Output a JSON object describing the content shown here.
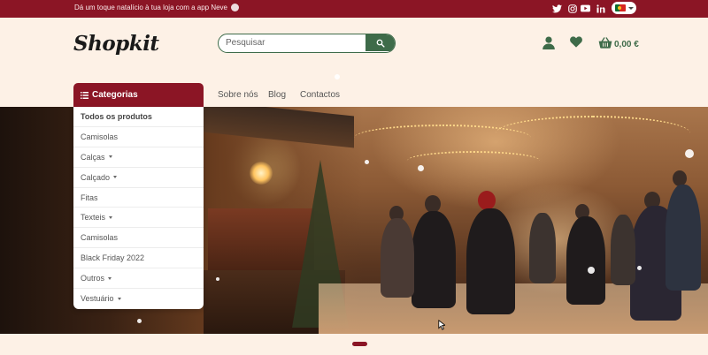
{
  "topbar": {
    "promo": "Dá um toque natalício à tua loja com a app Neve",
    "social": [
      "twitter-icon",
      "instagram-icon",
      "youtube-icon",
      "linkedin-icon"
    ],
    "language_flag": "pt-flag"
  },
  "header": {
    "logo": "Shopkit",
    "search_placeholder": "Pesquisar",
    "cart_total": "0,00 €"
  },
  "nav": {
    "categories_label": "Categorias",
    "links": [
      "Sobre nós",
      "Blog",
      "Contactos"
    ]
  },
  "categories": [
    {
      "label": "Todos os produtos",
      "has_submenu": false
    },
    {
      "label": "Camisolas",
      "has_submenu": false
    },
    {
      "label": "Calças",
      "has_submenu": true
    },
    {
      "label": "Calçado",
      "has_submenu": true
    },
    {
      "label": "Fitas",
      "has_submenu": false
    },
    {
      "label": "Texteis",
      "has_submenu": true
    },
    {
      "label": "Camisolas",
      "has_submenu": false
    },
    {
      "label": "Black Friday 2022",
      "has_submenu": false
    },
    {
      "label": "Outros",
      "has_submenu": true
    },
    {
      "label": "Vestuário",
      "has_submenu": true
    }
  ],
  "colors": {
    "brand_red": "#8b1525",
    "brand_green": "#3e6b49",
    "background": "#fdf1e6"
  },
  "carousel": {
    "slides": 1,
    "active": 1
  }
}
